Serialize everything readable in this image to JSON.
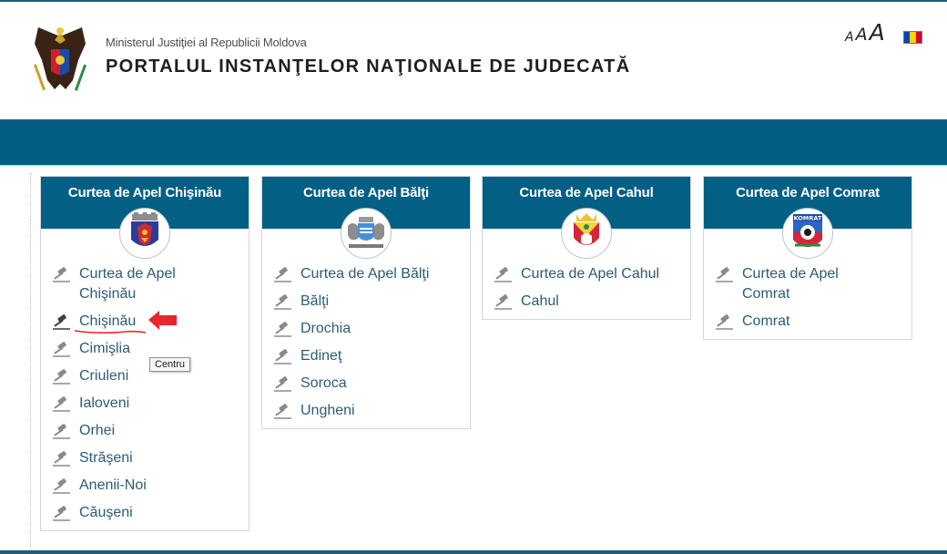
{
  "header": {
    "ministry": "Ministerul Justiţiei al Republicii Moldova",
    "title": "PORTALUL INSTANŢELOR NAŢIONALE DE JUDECATĂ",
    "logo_icon": "moldova-coat-of-arms-icon",
    "font_size_labels": [
      "A",
      "A",
      "A"
    ],
    "flag_icon": "moldova-flag-icon",
    "flag_colors": [
      "#0046ae",
      "#ffd200",
      "#cc092f"
    ]
  },
  "colors": {
    "primary": "#035f83",
    "link": "#2b5c74",
    "annotation_red": "#e8262d"
  },
  "panels": [
    {
      "title": "Curtea de Apel Chişinău",
      "emblem_icon": "chisinau-coat-of-arms-icon",
      "courts": [
        "Curtea de Apel Chişinău",
        "Chişinău",
        "Cimişlia",
        "Criuleni",
        "Ialoveni",
        "Orhei",
        "Străşeni",
        "Anenii-Noi",
        "Căuşeni"
      ]
    },
    {
      "title": "Curtea de Apel Bălţi",
      "emblem_icon": "balti-coat-of-arms-icon",
      "courts": [
        "Curtea de Apel Bălţi",
        "Bălţi",
        "Drochia",
        "Edineţ",
        "Soroca",
        "Ungheni"
      ]
    },
    {
      "title": "Curtea de Apel Cahul",
      "emblem_icon": "cahul-coat-of-arms-icon",
      "courts": [
        "Curtea de Apel Cahul",
        "Cahul"
      ]
    },
    {
      "title": "Curtea de Apel Comrat",
      "emblem_icon": "comrat-coat-of-arms-icon",
      "emblem_text": "KOMRAT",
      "courts": [
        "Curtea de Apel Comrat",
        "Comrat"
      ]
    }
  ],
  "tooltip": "Centru",
  "icons": {
    "court_item": "gavel-icon",
    "annotation": "red-arrow-icon"
  }
}
